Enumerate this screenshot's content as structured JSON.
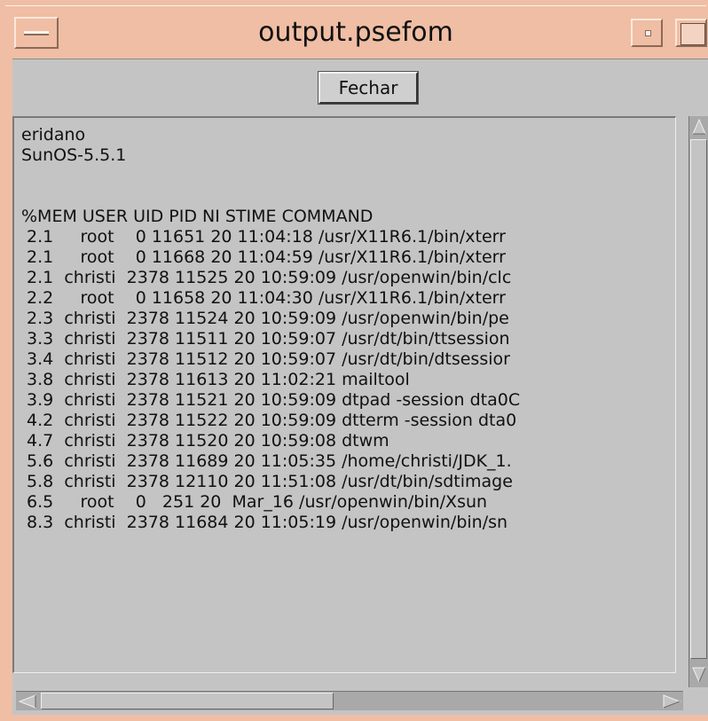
{
  "window": {
    "title": "output.psefom",
    "frame_color": "#efbea4",
    "client_color": "#c4c4c4"
  },
  "toolbar": {
    "close_label": "Fechar"
  },
  "output": {
    "lines": [
      "eridano",
      "SunOS-5.5.1",
      "",
      "",
      "%MEM USER UID PID NI STIME COMMAND",
      " 2.1     root    0 11651 20 11:04:18 /usr/X11R6.1/bin/xterr",
      " 2.1     root    0 11668 20 11:04:59 /usr/X11R6.1/bin/xterr",
      " 2.1  christi  2378 11525 20 10:59:09 /usr/openwin/bin/clc",
      " 2.2     root    0 11658 20 11:04:30 /usr/X11R6.1/bin/xterr",
      " 2.3  christi  2378 11524 20 10:59:09 /usr/openwin/bin/pe",
      " 3.3  christi  2378 11511 20 10:59:07 /usr/dt/bin/ttsession",
      " 3.4  christi  2378 11512 20 10:59:07 /usr/dt/bin/dtsessior",
      " 3.8  christi  2378 11613 20 11:02:21 mailtool",
      " 3.9  christi  2378 11521 20 10:59:09 dtpad -session dta0C",
      " 4.2  christi  2378 11522 20 10:59:09 dtterm -session dta0",
      " 4.7  christi  2378 11520 20 10:59:08 dtwm",
      " 5.6  christi  2378 11689 20 11:05:35 /home/christi/JDK_1.",
      " 5.8  christi  2378 12110 20 11:51:08 /usr/dt/bin/sdtimage",
      " 6.5     root    0   251 20  Mar_16 /usr/openwin/bin/Xsun",
      " 8.3  christi  2378 11684 20 11:05:19 /usr/openwin/bin/sn"
    ]
  },
  "icons": {
    "window_menu": "window-menu-icon",
    "minimize": "minimize-icon",
    "maximize": "maximize-icon",
    "scroll_up": "arrow-up-icon",
    "scroll_down": "arrow-down-icon",
    "scroll_left": "arrow-left-icon",
    "scroll_right": "arrow-right-icon"
  }
}
